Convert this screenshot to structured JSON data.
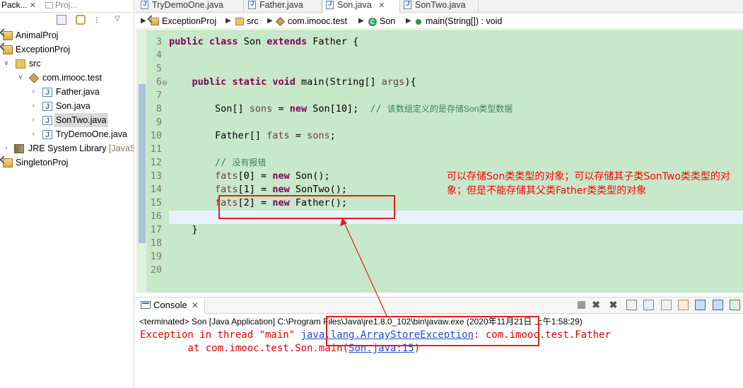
{
  "left_panel": {
    "tab_active": "Pack...",
    "tab_inactive": "Proj...",
    "tree": [
      {
        "label": "AnimalProj",
        "kind": "project"
      },
      {
        "label": "ExceptionProj",
        "kind": "project"
      },
      {
        "label": "src",
        "kind": "src"
      },
      {
        "label": "com.imooc.test",
        "kind": "package"
      },
      {
        "label": "Father.java",
        "kind": "java"
      },
      {
        "label": "Son.java",
        "kind": "java"
      },
      {
        "label": "SonTwo.java",
        "kind": "java",
        "selected": true
      },
      {
        "label": "TryDemoOne.java",
        "kind": "java"
      },
      {
        "label": "JRE System Library",
        "suffix": "[JavaS",
        "kind": "library"
      },
      {
        "label": "SingletonProj",
        "kind": "project"
      }
    ]
  },
  "editor_tabs": [
    "TryDemoOne.java",
    "Father.java",
    "Son.java",
    "SonTwo.java"
  ],
  "active_editor_tab": "Son.java",
  "breadcrumb": [
    "ExceptionProj",
    "src",
    "com.imooc.test",
    "Son",
    "main(String[]) : void"
  ],
  "line_numbers": [
    "3",
    "4",
    "5",
    "6",
    "7",
    "8",
    "9",
    "10",
    "11",
    "12",
    "13",
    "14",
    "15",
    "16",
    "17",
    "18",
    "19",
    "20"
  ],
  "code": {
    "l3_a": "public",
    "l3_b": " ",
    "l3_c": "class",
    "l3_d": " Son ",
    "l3_e": "extends",
    "l3_f": " Father {",
    "l6_a": "    ",
    "l6_b": "public",
    "l6_c": "static",
    "l6_d": "void",
    "l6_e": " main(String[] ",
    "l6_f": "args",
    "l6_g": "){",
    "l8_a": "        Son[] ",
    "l8_b": "sons",
    "l8_c": " = ",
    "l8_d": "new",
    "l8_e": " Son[10];  ",
    "l8_f": "// ",
    "l8_g": "该数组定义的是存储Son类型数据",
    "l10_a": "        Father[] ",
    "l10_b": "fats",
    "l10_c": " = ",
    "l10_d": "sons",
    "l10_e": ";",
    "l12_a": "        // ",
    "l12_b": "没有报错",
    "l13_a": "fats",
    "l13_b": "[0] = ",
    "l13_c": "new",
    "l13_d": " Son();",
    "l14_a": "fats",
    "l14_b": "[1] = ",
    "l14_c": "new",
    "l14_d": " SonTwo();",
    "l15_a": "fats",
    "l15_b": "[2] = ",
    "l15_c": "new",
    "l15_d": " Father();",
    "l17_a": "    }"
  },
  "annotation": "可以存储Son类类型的对象；可以存储其子类SonTwo类类型的对象；但是不能存储其父类Father类类型的对象",
  "console": {
    "tab_label": "Console",
    "terminated": "<terminated> Son [Java Application] C:\\Program Files\\Java\\jre1.8.0_102\\bin\\javaw.exe (2020年11月21日 上午1:58:29)",
    "ex_prefix": "Exception in thread \"main\" ",
    "ex_class": "java.lang.ArrayStoreException",
    "ex_suffix": ": com.imooc.test.Father",
    "at_prefix": "        at com.imooc.test.Son.main(",
    "at_link": "Son.java:15",
    "at_suffix": ")"
  },
  "colors": {
    "editor_bg": "#c8e8ca",
    "keyword": "#7f0055",
    "field": "#6a3e3e",
    "comment": "#3f7f5f",
    "annotation_red": "#ff0000",
    "error_red": "#e00000",
    "link_blue": "#1f4cd1"
  }
}
